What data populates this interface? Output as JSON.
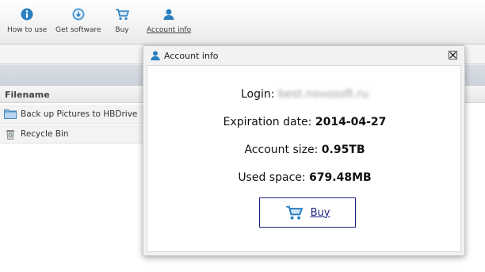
{
  "toolbar": {
    "how_to_use": "How to use",
    "get_software": "Get software",
    "buy": "Buy",
    "account_info": "Account info"
  },
  "file_list": {
    "column_header": "Filename",
    "rows": [
      {
        "name": "Back up Pictures to HBDrive",
        "icon": "folder-icon"
      },
      {
        "name": "Recycle Bin",
        "icon": "recycle-bin-icon"
      }
    ]
  },
  "dialog": {
    "title": "Account info",
    "login_label": "Login:",
    "login_value": "best.novosoft.ru",
    "expiration_label": "Expiration date:",
    "expiration_value": "2014-04-27",
    "account_size_label": "Account size:",
    "account_size_value": "0.95TB",
    "used_space_label": "Used space:",
    "used_space_value": "679.48MB",
    "buy_button": "Buy"
  },
  "colors": {
    "accent_blue": "#2a7fc0",
    "button_border": "#1a237e"
  }
}
